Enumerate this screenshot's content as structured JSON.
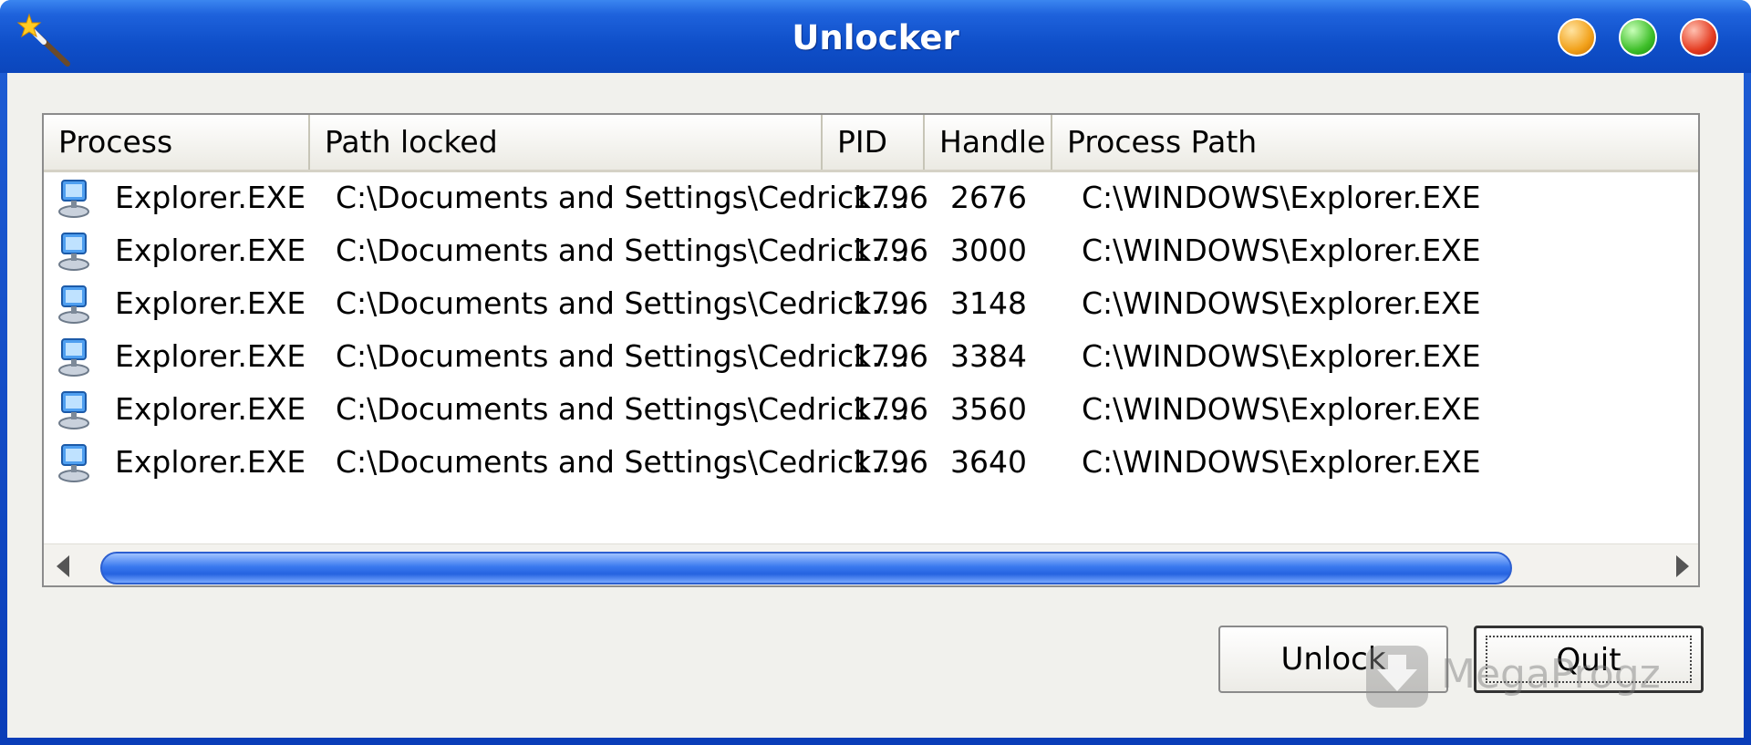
{
  "window": {
    "title": "Unlocker"
  },
  "icons": {
    "app": "magic-wand-icon",
    "row": "computer-icon",
    "min": "minimize-icon",
    "max": "maximize-icon",
    "close": "close-icon"
  },
  "columns": [
    "Process",
    "Path locked",
    "PID",
    "Handle",
    "Process Path"
  ],
  "rows": [
    {
      "process": "Explorer.EXE",
      "path": "C:\\Documents and Settings\\Cedrick....",
      "pid": "1796",
      "handle": "2676",
      "process_path": "C:\\WINDOWS\\Explorer.EXE"
    },
    {
      "process": "Explorer.EXE",
      "path": "C:\\Documents and Settings\\Cedrick....",
      "pid": "1796",
      "handle": "3000",
      "process_path": "C:\\WINDOWS\\Explorer.EXE"
    },
    {
      "process": "Explorer.EXE",
      "path": "C:\\Documents and Settings\\Cedrick....",
      "pid": "1796",
      "handle": "3148",
      "process_path": "C:\\WINDOWS\\Explorer.EXE"
    },
    {
      "process": "Explorer.EXE",
      "path": "C:\\Documents and Settings\\Cedrick....",
      "pid": "1796",
      "handle": "3384",
      "process_path": "C:\\WINDOWS\\Explorer.EXE"
    },
    {
      "process": "Explorer.EXE",
      "path": "C:\\Documents and Settings\\Cedrick....",
      "pid": "1796",
      "handle": "3560",
      "process_path": "C:\\WINDOWS\\Explorer.EXE"
    },
    {
      "process": "Explorer.EXE",
      "path": "C:\\Documents and Settings\\Cedrick....",
      "pid": "1796",
      "handle": "3640",
      "process_path": "C:\\WINDOWS\\Explorer.EXE"
    }
  ],
  "buttons": {
    "unlock": "Unlock",
    "quit": "Quit"
  },
  "watermark": {
    "text": "MegaProgz"
  },
  "colors": {
    "titlebar": "#0f4fc9",
    "scroll_thumb": "#2563e0",
    "client": "#f1f1ed"
  }
}
